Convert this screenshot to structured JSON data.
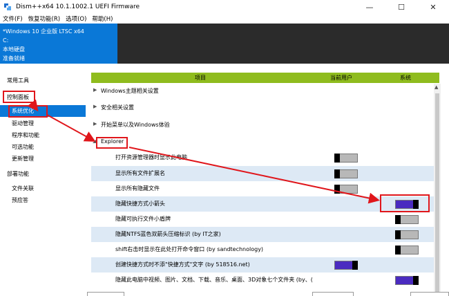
{
  "window": {
    "title": "Dism++x64 10.1.1002.1 UEFI Firmware",
    "minimize": "—",
    "maximize": "☐",
    "close": "✕"
  },
  "menu": [
    "文件(F)",
    "恢复功能(R)",
    "选项(O)",
    "帮助(H)"
  ],
  "session": {
    "name": "*Windows 10 企业版 LTSC x64",
    "drive": "C:",
    "disk": "本地硬盘",
    "status": "准备就绪"
  },
  "sidebar": {
    "sections": [
      {
        "label": "常用工具"
      },
      {
        "label": "控制面板"
      },
      {
        "label": "系统优化",
        "selected": true
      },
      {
        "label": "驱动管理"
      },
      {
        "label": "程序和功能"
      },
      {
        "label": "可选功能"
      },
      {
        "label": "更新管理"
      },
      {
        "label": "部署功能"
      },
      {
        "label": "文件关联"
      },
      {
        "label": "预应答"
      }
    ]
  },
  "table": {
    "headers": {
      "item": "项目",
      "current_user": "当前用户",
      "system": "系统"
    },
    "groups": [
      {
        "label": "Windows主题相关设置",
        "expanded": false
      },
      {
        "label": "安全相关设置",
        "expanded": false
      },
      {
        "label": "开始菜单以及Windows体验",
        "expanded": false
      },
      {
        "label": "Explorer",
        "expanded": true
      }
    ],
    "rows": [
      {
        "label": "打开资源管理器时显示此电脑",
        "user": "off",
        "system": null
      },
      {
        "label": "显示所有文件扩展名",
        "user": "off",
        "system": null
      },
      {
        "label": "显示所有隐藏文件",
        "user": "off",
        "system": null
      },
      {
        "label": "隐藏快捷方式小箭头",
        "user": null,
        "system": "on"
      },
      {
        "label": "隐藏可执行文件小盾牌",
        "user": null,
        "system": "off"
      },
      {
        "label": "隐藏NTFS蓝色双箭头压缩标识 (by IT之家)",
        "user": null,
        "system": "off"
      },
      {
        "label": "shift右击时显示在此处打开命令窗口 (by sandtechnology)",
        "user": null,
        "system": "off"
      },
      {
        "label": "创建快捷方式时不添\"快捷方式\"文字 (by 518516.net)",
        "user": "on",
        "system": null
      },
      {
        "label": "隐藏此电脑中视频、图片、文档、下载、音乐、桌面、3D对象七个文件夹 (by、(",
        "user": null,
        "system": "on"
      }
    ]
  },
  "colors": {
    "accent": "#0a78d7",
    "header_green": "#8fbc1e",
    "row_alt": "#dde9f5",
    "toggle_on": "#4a2bc0",
    "annotation_red": "#e0161b"
  }
}
